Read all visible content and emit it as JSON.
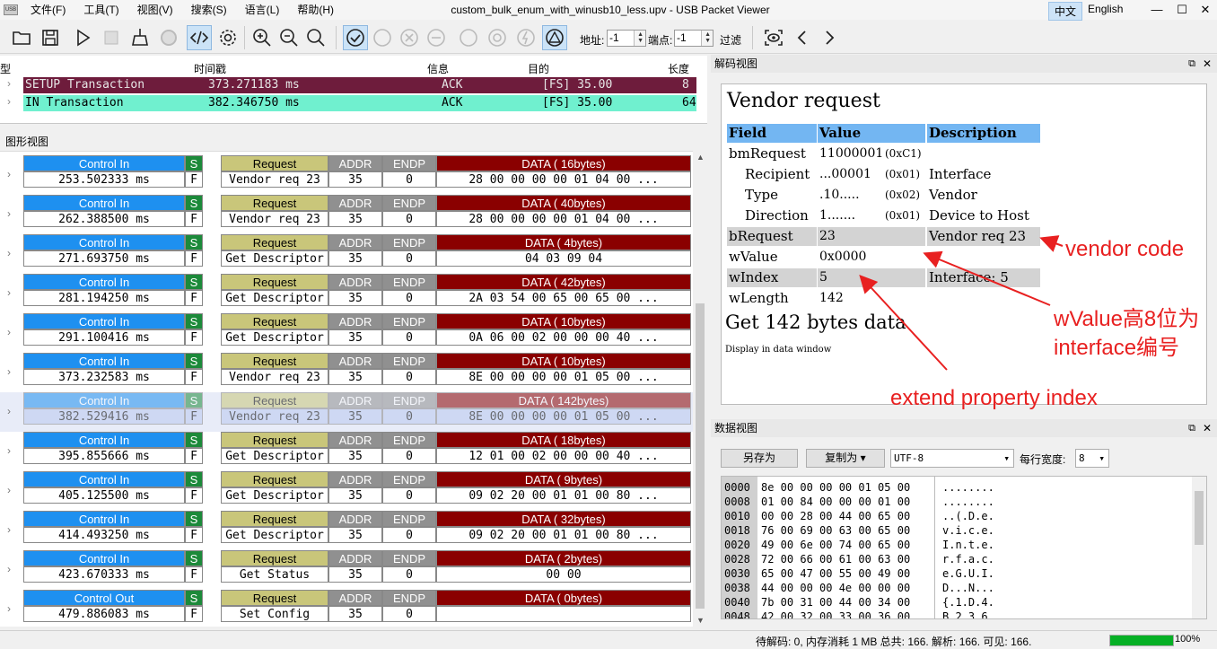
{
  "window": {
    "title": "custom_bulk_enum_with_winusb10_less.upv - USB Packet Viewer",
    "app_icon": "USB"
  },
  "menu": [
    "文件(F)",
    "工具(T)",
    "视图(V)",
    "搜索(S)",
    "语言(L)",
    "帮助(H)"
  ],
  "language": {
    "zh": "中文",
    "en": "English"
  },
  "window_controls": {
    "minimize": "—",
    "maximize": "☐",
    "close": "✕"
  },
  "toolbar": {
    "addr_label": "地址:",
    "addr_value": "-1",
    "endp_label": "端点:",
    "endp_value": "-1",
    "filter_label": "过滤"
  },
  "txlist": {
    "headers": [
      "型",
      "时间戳",
      "信息",
      "目的",
      "长度"
    ],
    "rows": [
      {
        "type": "SETUP Transaction",
        "time": "373.271183 ms",
        "info": "ACK",
        "dest": "[FS] 35.00",
        "len": "8",
        "bg": "#6e1c3c",
        "fg": "#e7e7e7"
      },
      {
        "type": "IN Transaction",
        "time": "382.346750 ms",
        "info": "ACK",
        "dest": "[FS] 35.00",
        "len": "64",
        "bg": "#70f0cf",
        "fg": "#000000"
      }
    ]
  },
  "packet_view": {
    "title": "图形视图",
    "packets": [
      {
        "dir": "Control In",
        "time": "253.502333 ms",
        "s": "S",
        "f": "F",
        "req": "Request",
        "req_name": "Vendor req 23",
        "addr_h": "ADDR",
        "addr": "35",
        "endp_h": "ENDP",
        "endp": "0",
        "data_h": "DATA ( 16bytes)",
        "data": "28 00 00 00 00 01 04 00 ..."
      },
      {
        "dir": "Control In",
        "time": "262.388500 ms",
        "s": "S",
        "f": "F",
        "req": "Request",
        "req_name": "Vendor req 23",
        "addr_h": "ADDR",
        "addr": "35",
        "endp_h": "ENDP",
        "endp": "0",
        "data_h": "DATA ( 40bytes)",
        "data": "28 00 00 00 00 01 04 00 ..."
      },
      {
        "dir": "Control In",
        "time": "271.693750 ms",
        "s": "S",
        "f": "F",
        "req": "Request",
        "req_name": "Get Descriptor",
        "addr_h": "ADDR",
        "addr": "35",
        "endp_h": "ENDP",
        "endp": "0",
        "data_h": "DATA ( 4bytes)",
        "data": "04 03 09 04"
      },
      {
        "dir": "Control In",
        "time": "281.194250 ms",
        "s": "S",
        "f": "F",
        "req": "Request",
        "req_name": "Get Descriptor",
        "addr_h": "ADDR",
        "addr": "35",
        "endp_h": "ENDP",
        "endp": "0",
        "data_h": "DATA ( 42bytes)",
        "data": "2A 03 54 00 65 00 65 00 ..."
      },
      {
        "dir": "Control In",
        "time": "291.100416 ms",
        "s": "S",
        "f": "F",
        "req": "Request",
        "req_name": "Get Descriptor",
        "addr_h": "ADDR",
        "addr": "35",
        "endp_h": "ENDP",
        "endp": "0",
        "data_h": "DATA ( 10bytes)",
        "data": "0A 06 00 02 00 00 00 40 ..."
      },
      {
        "dir": "Control In",
        "time": "373.232583 ms",
        "s": "S",
        "f": "F",
        "req": "Request",
        "req_name": "Vendor req 23",
        "addr_h": "ADDR",
        "addr": "35",
        "endp_h": "ENDP",
        "endp": "0",
        "data_h": "DATA ( 10bytes)",
        "data": "8E 00 00 00 00 01 05 00 ..."
      },
      {
        "dir": "Control In",
        "time": "382.529416 ms",
        "s": "S",
        "f": "F",
        "req": "Request",
        "req_name": "Vendor req 23",
        "addr_h": "ADDR",
        "addr": "35",
        "endp_h": "ENDP",
        "endp": "0",
        "data_h": "DATA ( 142bytes)",
        "data": "8E 00 00 00 00 01 05 00 ...",
        "selected": true
      },
      {
        "dir": "Control In",
        "time": "395.855666 ms",
        "s": "S",
        "f": "F",
        "req": "Request",
        "req_name": "Get Descriptor",
        "addr_h": "ADDR",
        "addr": "35",
        "endp_h": "ENDP",
        "endp": "0",
        "data_h": "DATA ( 18bytes)",
        "data": "12 01 00 02 00 00 00 40 ..."
      },
      {
        "dir": "Control In",
        "time": "405.125500 ms",
        "s": "S",
        "f": "F",
        "req": "Request",
        "req_name": "Get Descriptor",
        "addr_h": "ADDR",
        "addr": "35",
        "endp_h": "ENDP",
        "endp": "0",
        "data_h": "DATA ( 9bytes)",
        "data": "09 02 20 00 01 01 00 80 ..."
      },
      {
        "dir": "Control In",
        "time": "414.493250 ms",
        "s": "S",
        "f": "F",
        "req": "Request",
        "req_name": "Get Descriptor",
        "addr_h": "ADDR",
        "addr": "35",
        "endp_h": "ENDP",
        "endp": "0",
        "data_h": "DATA ( 32bytes)",
        "data": "09 02 20 00 01 01 00 80 ..."
      },
      {
        "dir": "Control In",
        "time": "423.670333 ms",
        "s": "S",
        "f": "F",
        "req": "Request",
        "req_name": "Get Status",
        "addr_h": "ADDR",
        "addr": "35",
        "endp_h": "ENDP",
        "endp": "0",
        "data_h": "DATA ( 2bytes)",
        "data": "00 00"
      },
      {
        "dir": "Control Out",
        "time": "479.886083 ms",
        "s": "S",
        "f": "F",
        "req": "Request",
        "req_name": "Set Config",
        "addr_h": "ADDR",
        "addr": "35",
        "endp_h": "ENDP",
        "endp": "0",
        "data_h": "DATA ( 0bytes)",
        "data": ""
      }
    ]
  },
  "decode": {
    "title": "解码视图",
    "heading": "Vendor request",
    "headers": [
      "Field",
      "Value",
      "Description"
    ],
    "rows": [
      {
        "field": "bmRequest",
        "value": "11000001",
        "hex": "(0xC1)",
        "desc": ""
      },
      {
        "field": "Recipient",
        "value": "...00001",
        "hex": "(0x01)",
        "desc": "Interface"
      },
      {
        "field": "Type",
        "value": ".10.....",
        "hex": "(0x02)",
        "desc": "Vendor"
      },
      {
        "field": "Direction",
        "value": "1.......",
        "hex": "(0x01)",
        "desc": "Device to Host"
      },
      {
        "field": "bRequest",
        "value": "23",
        "hex": "",
        "desc": "Vendor req 23"
      },
      {
        "field": "wValue",
        "value": "0x0000",
        "hex": "",
        "desc": ""
      },
      {
        "field": "wIndex",
        "value": "5",
        "hex": "",
        "desc": "Interface: 5"
      },
      {
        "field": "wLength",
        "value": "142",
        "hex": "",
        "desc": ""
      }
    ],
    "get_line": "Get 142 bytes data",
    "note": "Display in data window"
  },
  "annotations": {
    "vendor_code": "vendor code",
    "wvalue_1": "wValue高8位为",
    "wvalue_2": "interface编号",
    "extend": "extend property index"
  },
  "dataview": {
    "title": "数据视图",
    "save_as": "另存为",
    "copy_as": "复制为",
    "encoding": "UTF-8",
    "width_label": "每行宽度:",
    "width_value": "8",
    "lines": [
      {
        "addr": "0000",
        "hex": "8e 00 00 00 00 01 05 00",
        "ascii": "........"
      },
      {
        "addr": "0008",
        "hex": "01 00 84 00 00 00 01 00",
        "ascii": "........"
      },
      {
        "addr": "0010",
        "hex": "00 00 28 00 44 00 65 00",
        "ascii": "..(.D.e."
      },
      {
        "addr": "0018",
        "hex": "76 00 69 00 63 00 65 00",
        "ascii": "v.i.c.e."
      },
      {
        "addr": "0020",
        "hex": "49 00 6e 00 74 00 65 00",
        "ascii": "I.n.t.e."
      },
      {
        "addr": "0028",
        "hex": "72 00 66 00 61 00 63 00",
        "ascii": "r.f.a.c."
      },
      {
        "addr": "0030",
        "hex": "65 00 47 00 55 00 49 00",
        "ascii": "e.G.U.I."
      },
      {
        "addr": "0038",
        "hex": "44 00 00 00 4e 00 00 00",
        "ascii": "D...N..."
      },
      {
        "addr": "0040",
        "hex": "7b 00 31 00 44 00 34 00",
        "ascii": "{.1.D.4."
      },
      {
        "addr": "0048",
        "hex": "42 00 32 00 33 00 36 00",
        "ascii": "B.2.3.6."
      }
    ]
  },
  "status": {
    "text": "待解码: 0, 内存消耗 1 MB 总共: 166. 解析: 166. 可见: 166.",
    "progress": 100,
    "progress_label": "100%"
  },
  "colors": {
    "control": "#1e90f0",
    "sync": "#1c8a3a",
    "request": "#c9c67a",
    "addr": "#909090",
    "data": "#8a0000",
    "annotation": "#e82020",
    "header": "#73b6f2"
  }
}
